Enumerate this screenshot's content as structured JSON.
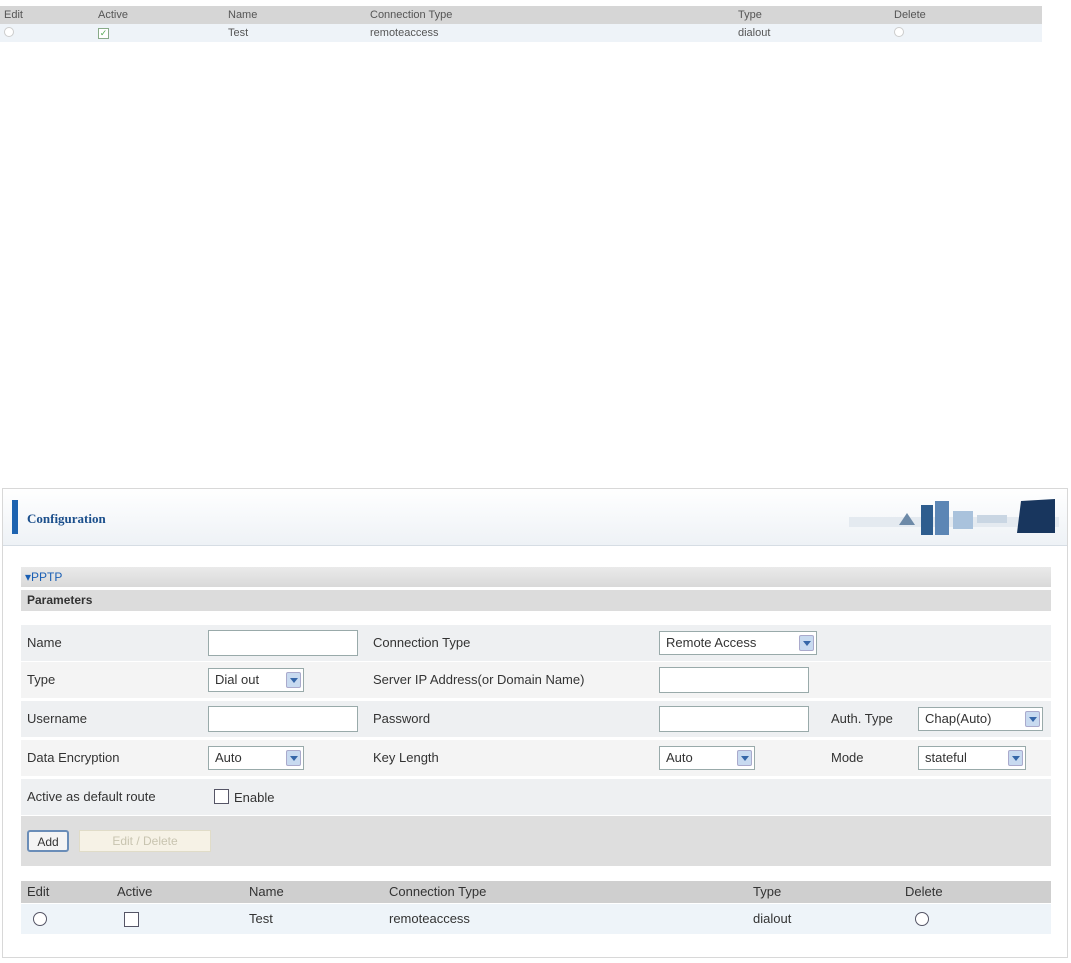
{
  "top_table": {
    "headers": [
      "Edit",
      "Active",
      "Name",
      "Connection Type",
      "Type",
      "Delete"
    ],
    "row": {
      "active_checked": "✓",
      "name": "Test",
      "connection_type": "remoteaccess",
      "type": "dialout"
    }
  },
  "config": {
    "title": "Configuration",
    "section": "▾PPTP",
    "parameters_label": "Parameters",
    "fields": {
      "name_label": "Name",
      "name_value": "",
      "connection_type_label": "Connection Type",
      "connection_type_value": "Remote Access",
      "type_label": "Type",
      "type_value": "Dial out",
      "server_ip_label": "Server IP Address(or Domain Name)",
      "server_ip_value": "",
      "username_label": "Username",
      "username_value": "",
      "password_label": "Password",
      "password_value": "",
      "auth_type_label": "Auth. Type",
      "auth_type_value": "Chap(Auto)",
      "data_encryption_label": "Data Encryption",
      "data_encryption_value": "Auto",
      "key_length_label": "Key Length",
      "key_length_value": "Auto",
      "mode_label": "Mode",
      "mode_value": "stateful",
      "default_route_label": "Active as default route",
      "enable_label": "Enable"
    },
    "buttons": {
      "add": "Add",
      "edit_delete": "Edit / Delete"
    },
    "table": {
      "headers": [
        "Edit",
        "Active",
        "Name",
        "Connection Type",
        "Type",
        "Delete"
      ],
      "rows": [
        {
          "name": "Test",
          "connection_type": "remoteaccess",
          "type": "dialout"
        }
      ]
    }
  },
  "colors": {
    "accent": "#1d63b0",
    "section_text": "#1a5fb4"
  }
}
